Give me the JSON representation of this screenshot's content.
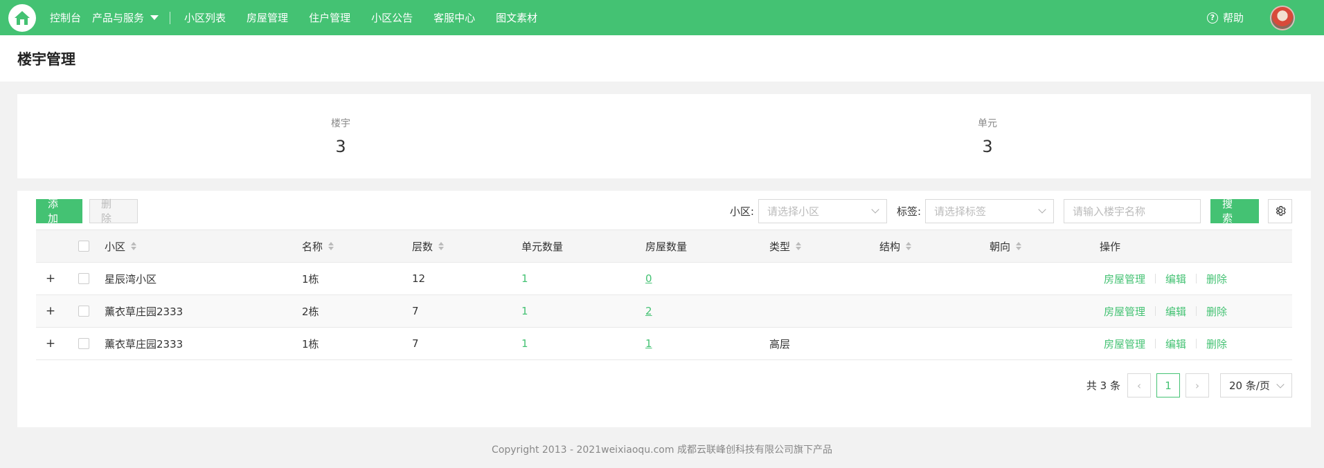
{
  "nav": {
    "items": [
      "控制台",
      "产品与服务",
      "小区列表",
      "房屋管理",
      "住户管理",
      "小区公告",
      "客服中心",
      "图文素材"
    ],
    "help": "帮助"
  },
  "page": {
    "title": "楼宇管理"
  },
  "stats": [
    {
      "label": "楼宇",
      "value": "3"
    },
    {
      "label": "单元",
      "value": "3"
    }
  ],
  "toolbar": {
    "add": "添加",
    "delete": "删除",
    "community_label": "小区:",
    "community_placeholder": "请选择小区",
    "tag_label": "标签:",
    "tag_placeholder": "请选择标签",
    "name_placeholder": "请输入楼宇名称",
    "search": "搜索"
  },
  "table": {
    "columns": [
      "小区",
      "名称",
      "层数",
      "单元数量",
      "房屋数量",
      "类型",
      "结构",
      "朝向",
      "操作"
    ],
    "rows": [
      {
        "community": "星辰湾小区",
        "name": "1栋",
        "floors": "12",
        "units": "1",
        "houses": "0",
        "type": ""
      },
      {
        "community": "薰衣草庄园2333",
        "name": "2栋",
        "floors": "7",
        "units": "1",
        "houses": "2",
        "type": ""
      },
      {
        "community": "薰衣草庄园2333",
        "name": "1栋",
        "floors": "7",
        "units": "1",
        "houses": "1",
        "type": "高层"
      }
    ],
    "ops": [
      "房屋管理",
      "编辑",
      "删除"
    ]
  },
  "pagination": {
    "total": "共 3 条",
    "page": "1",
    "size": "20 条/页"
  },
  "footer": "Copyright 2013 - 2021weixiaoqu.com 成都云联峰创科技有限公司旗下产品",
  "colors": {
    "brand": "#44c273"
  }
}
